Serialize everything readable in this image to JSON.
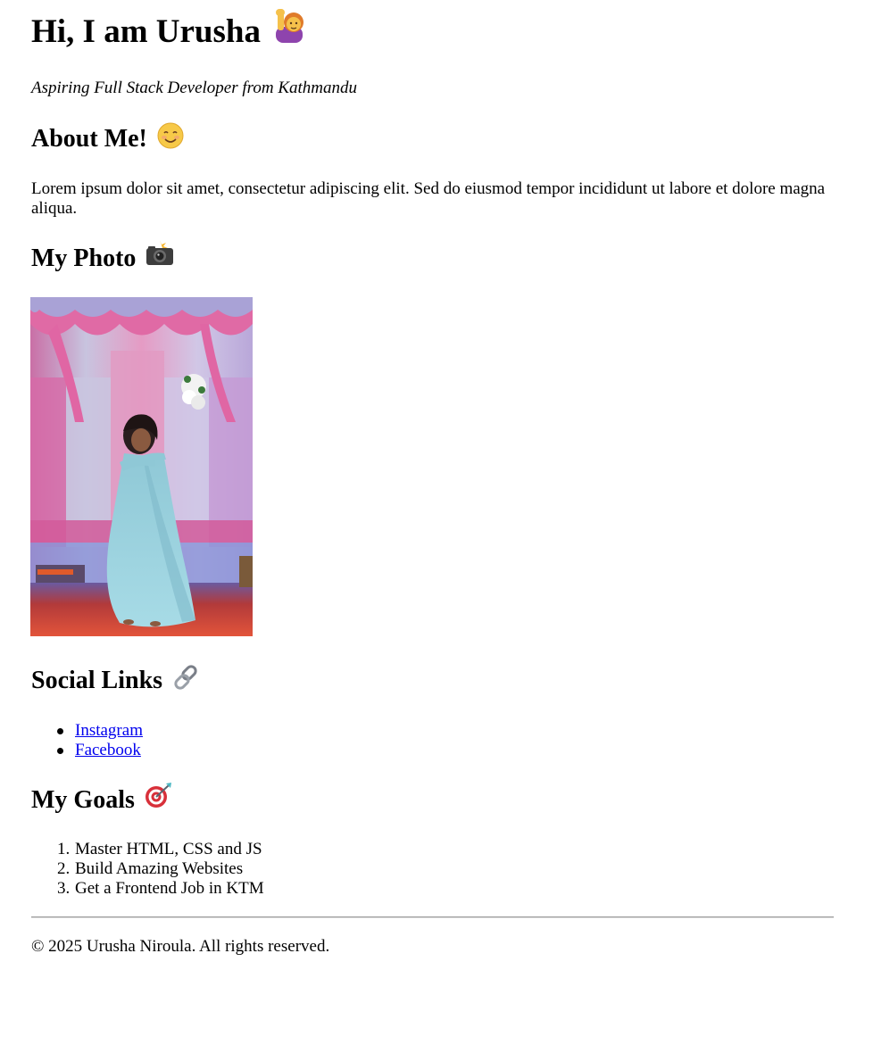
{
  "header": {
    "title": "Hi, I am Urusha",
    "title_icon": "raising-hand-woman-icon",
    "tagline": "Aspiring Full Stack Developer from Kathmandu"
  },
  "about": {
    "heading": "About Me!",
    "heading_icon": "smiling-face-icon",
    "text": "Lorem ipsum dolor sit amet, consectetur adipiscing elit. Sed do eiusmod tempor incididunt ut labore et dolore magna aliqua."
  },
  "photo": {
    "heading": "My Photo",
    "heading_icon": "camera-flash-icon",
    "image_icon": "dancer-photo"
  },
  "social": {
    "heading": "Social Links",
    "heading_icon": "link-icon",
    "links": [
      {
        "label": "Instagram"
      },
      {
        "label": "Facebook"
      }
    ]
  },
  "goals": {
    "heading": "My Goals",
    "heading_icon": "target-icon",
    "items": [
      {
        "num": "1.",
        "label": "Master HTML, CSS and JS"
      },
      {
        "num": "2.",
        "label": "Build Amazing Websites"
      },
      {
        "num": "3.",
        "label": "Get a Frontend Job in KTM"
      }
    ]
  },
  "footer": {
    "text": "© 2025 Urusha Niroula. All rights reserved."
  },
  "colors": {
    "link": "#0000ee",
    "text": "#000000",
    "divider": "#999999"
  }
}
